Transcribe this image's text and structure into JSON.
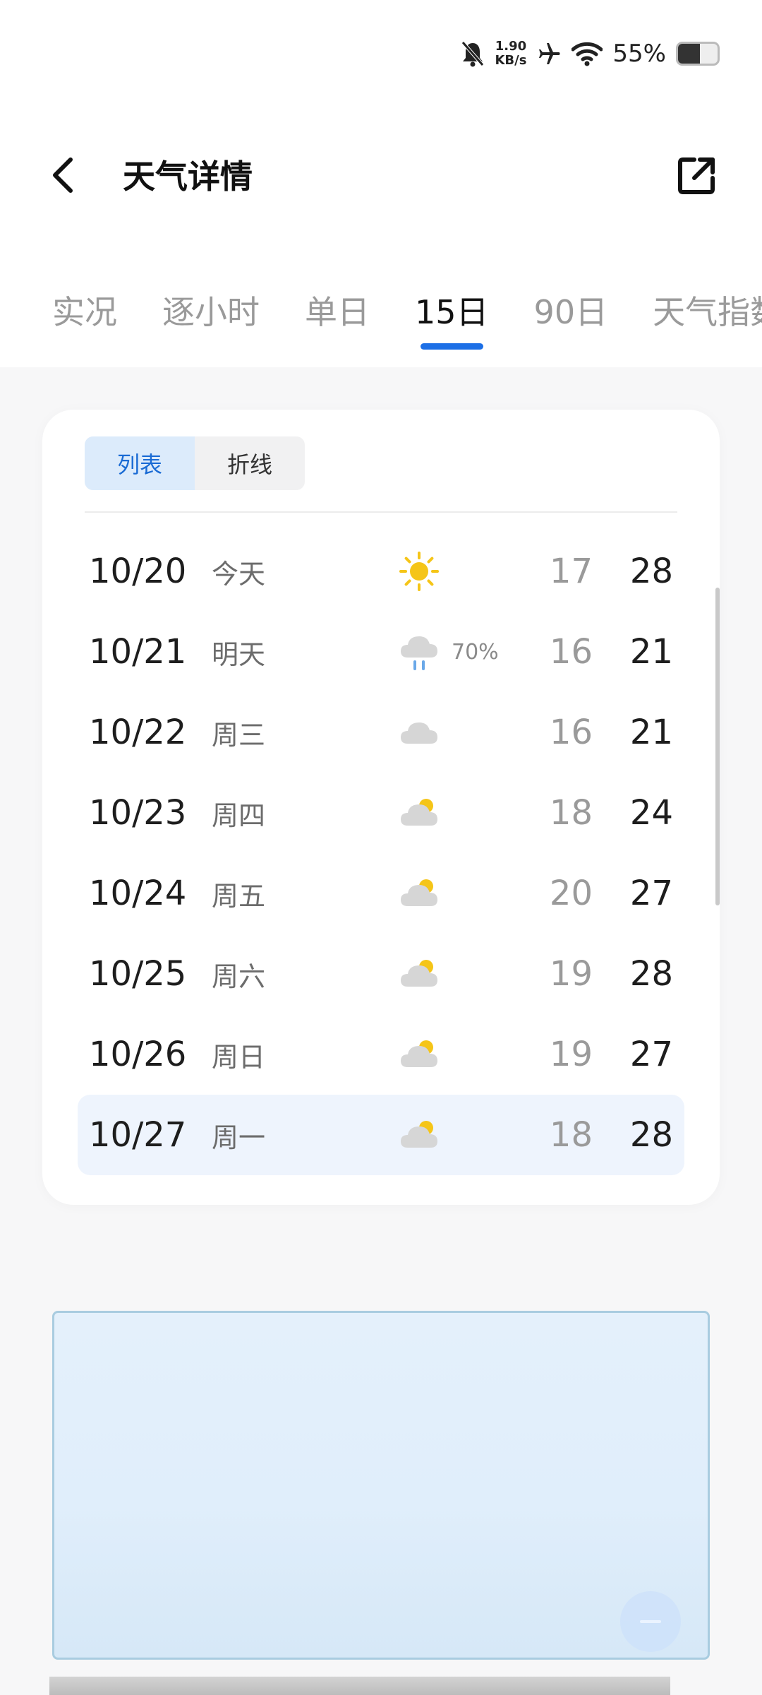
{
  "status_bar": {
    "net_speed_value": "1.90",
    "net_speed_unit": "KB/s",
    "battery_percent": "55%",
    "battery_level": 0.55,
    "icons": [
      "mute-bell-icon",
      "airplane-icon",
      "wifi-icon",
      "battery-icon"
    ]
  },
  "header": {
    "title": "天气详情",
    "back_icon": "chevron-left-icon",
    "share_icon": "share-external-icon"
  },
  "tabs": [
    {
      "label": "实况",
      "active": false
    },
    {
      "label": "逐小时",
      "active": false
    },
    {
      "label": "单日",
      "active": false
    },
    {
      "label": "15日",
      "active": true
    },
    {
      "label": "90日",
      "active": false
    },
    {
      "label": "天气指数",
      "active": false
    }
  ],
  "view_toggle": {
    "list_label": "列表",
    "line_label": "折线",
    "selected": "列表"
  },
  "forecast": [
    {
      "date": "10/20",
      "weekday": "今天",
      "icon": "sunny-icon",
      "precip": "",
      "low": "17",
      "high": "28"
    },
    {
      "date": "10/21",
      "weekday": "明天",
      "icon": "rain-icon",
      "precip": "70%",
      "low": "16",
      "high": "21"
    },
    {
      "date": "10/22",
      "weekday": "周三",
      "icon": "cloudy-icon",
      "precip": "",
      "low": "16",
      "high": "21"
    },
    {
      "date": "10/23",
      "weekday": "周四",
      "icon": "partly-cloudy-icon",
      "precip": "",
      "low": "18",
      "high": "24"
    },
    {
      "date": "10/24",
      "weekday": "周五",
      "icon": "partly-cloudy-icon",
      "precip": "",
      "low": "20",
      "high": "27"
    },
    {
      "date": "10/25",
      "weekday": "周六",
      "icon": "partly-cloudy-icon",
      "precip": "",
      "low": "19",
      "high": "28"
    },
    {
      "date": "10/26",
      "weekday": "周日",
      "icon": "partly-cloudy-icon",
      "precip": "",
      "low": "19",
      "high": "27"
    },
    {
      "date": "10/27",
      "weekday": "周一",
      "icon": "partly-cloudy-icon",
      "precip": "",
      "low": "18",
      "high": "28",
      "highlighted": true
    }
  ],
  "colors": {
    "accent": "#1c6fe6",
    "sun": "#f5c518",
    "cloud": "#d6d6d6",
    "rain": "#6aa8e8",
    "highlight_row": "#eef4fd"
  }
}
